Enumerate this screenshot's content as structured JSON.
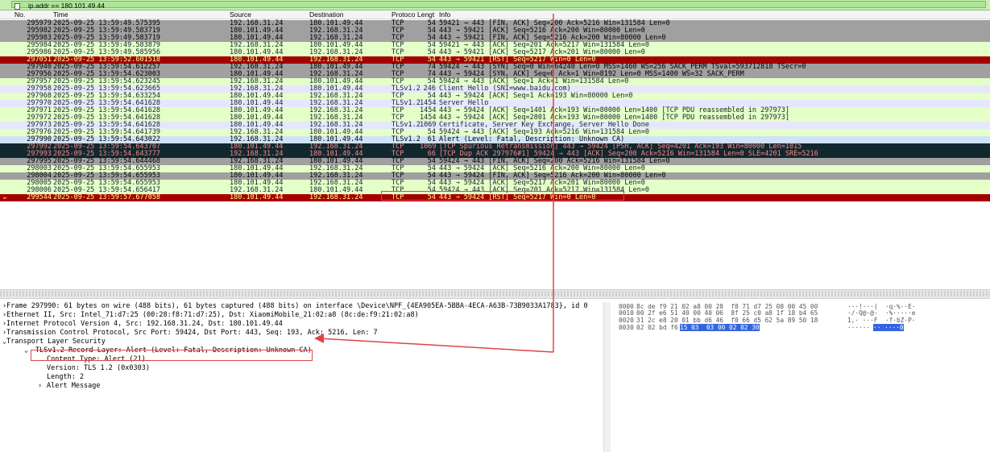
{
  "filter": {
    "value": "ip.addr == 180.101.49.44"
  },
  "columns": {
    "no": "No.",
    "time": "Time",
    "source": "Source",
    "destination": "Destination",
    "protocol": "Protoco",
    "length": "Lengt",
    "info": "Info"
  },
  "packets": [
    {
      "no": "295979",
      "time": "2025-09-25 13:59:49.575395",
      "src": "192.168.31.24",
      "dst": "180.101.49.44",
      "proto": "TCP",
      "len": "54",
      "info": "59421 → 443 [FIN, ACK] Seq=200 Ack=5216 Win=131584 Len=0"
    },
    {
      "no": "295982",
      "time": "2025-09-25 13:59:49.583719",
      "src": "180.101.49.44",
      "dst": "192.168.31.24",
      "proto": "TCP",
      "len": "54",
      "info": "443 → 59421 [ACK] Seq=5216 Ack=200 Win=80000 Len=0"
    },
    {
      "no": "295983",
      "time": "2025-09-25 13:59:49.583719",
      "src": "180.101.49.44",
      "dst": "192.168.31.24",
      "proto": "TCP",
      "len": "54",
      "info": "443 → 59421 [FIN, ACK] Seq=5216 Ack=200 Win=80000 Len=0"
    },
    {
      "no": "295984",
      "time": "2025-09-25 13:59:49.583879",
      "src": "192.168.31.24",
      "dst": "180.101.49.44",
      "proto": "TCP",
      "len": "54",
      "info": "59421 → 443 [ACK] Seq=201 Ack=5217 Win=131584 Len=0"
    },
    {
      "no": "295986",
      "time": "2025-09-25 13:59:49.585956",
      "src": "180.101.49.44",
      "dst": "192.168.31.24",
      "proto": "TCP",
      "len": "54",
      "info": "443 → 59421 [ACK] Seq=5217 Ack=201 Win=80000 Len=0"
    },
    {
      "no": "297051",
      "time": "2025-09-25 13:59:52.601518",
      "src": "180.101.49.44",
      "dst": "192.168.31.24",
      "proto": "TCP",
      "len": "54",
      "info": "443 → 59421 [RST] Seq=5217 Win=0 Len=0"
    },
    {
      "no": "297940",
      "time": "2025-09-25 13:59:54.612257",
      "src": "192.168.31.24",
      "dst": "180.101.49.44",
      "proto": "TCP",
      "len": "74",
      "info": "59424 → 443 [SYN] Seq=0 Win=64240 Len=0 MSS=1460 WS=256 SACK_PERM TSval=593712818 TSecr=0"
    },
    {
      "no": "297956",
      "time": "2025-09-25 13:59:54.623003",
      "src": "180.101.49.44",
      "dst": "192.168.31.24",
      "proto": "TCP",
      "len": "74",
      "info": "443 → 59424 [SYN, ACK] Seq=0 Ack=1 Win=8192 Len=0 MSS=1400 WS=32 SACK_PERM"
    },
    {
      "no": "297957",
      "time": "2025-09-25 13:59:54.623245",
      "src": "192.168.31.24",
      "dst": "180.101.49.44",
      "proto": "TCP",
      "len": "54",
      "info": "59424 → 443 [ACK] Seq=1 Ack=1 Win=131584 Len=0"
    },
    {
      "no": "297958",
      "time": "2025-09-25 13:59:54.623665",
      "src": "192.168.31.24",
      "dst": "180.101.49.44",
      "proto": "TLSv1.2",
      "len": "246",
      "info": "Client Hello (SNI=www.baidu.com)"
    },
    {
      "no": "297968",
      "time": "2025-09-25 13:59:54.633254",
      "src": "180.101.49.44",
      "dst": "192.168.31.24",
      "proto": "TCP",
      "len": "54",
      "info": "443 → 59424 [ACK] Seq=1 Ack=193 Win=80000 Len=0"
    },
    {
      "no": "297970",
      "time": "2025-09-25 13:59:54.641628",
      "src": "180.101.49.44",
      "dst": "192.168.31.24",
      "proto": "TLSv1.2",
      "len": "1454",
      "info": "Server Hello"
    },
    {
      "no": "297971",
      "time": "2025-09-25 13:59:54.641628",
      "src": "180.101.49.44",
      "dst": "192.168.31.24",
      "proto": "TCP",
      "len": "1454",
      "info": "443 → 59424 [ACK] Seq=1401 Ack=193 Win=80000 Len=1400 [TCP PDU reassembled in 297973]"
    },
    {
      "no": "297972",
      "time": "2025-09-25 13:59:54.641628",
      "src": "180.101.49.44",
      "dst": "192.168.31.24",
      "proto": "TCP",
      "len": "1454",
      "info": "443 → 59424 [ACK] Seq=2801 Ack=193 Win=80000 Len=1400 [TCP PDU reassembled in 297973]"
    },
    {
      "no": "297973",
      "time": "2025-09-25 13:59:54.641628",
      "src": "180.101.49.44",
      "dst": "192.168.31.24",
      "proto": "TLSv1.2",
      "len": "1069",
      "info": "Certificate, Server Key Exchange, Server Hello Done"
    },
    {
      "no": "297976",
      "time": "2025-09-25 13:59:54.641739",
      "src": "192.168.31.24",
      "dst": "180.101.49.44",
      "proto": "TCP",
      "len": "54",
      "info": "59424 → 443 [ACK] Seq=193 Ack=5216 Win=131584 Len=0"
    },
    {
      "no": "297990",
      "time": "2025-09-25 13:59:54.643022",
      "src": "192.168.31.24",
      "dst": "180.101.49.44",
      "proto": "TLSv1.2",
      "len": "61",
      "info": "Alert (Level: Fatal, Description: Unknown CA)"
    },
    {
      "no": "297992",
      "time": "2025-09-25 13:59:54.643707",
      "src": "180.101.49.44",
      "dst": "192.168.31.24",
      "proto": "TCP",
      "len": "1069",
      "info": "[TCP Spurious Retransmission] 443 → 59424 [PSH, ACK] Seq=4201 Ack=193 Win=80000 Len=1015"
    },
    {
      "no": "297993",
      "time": "2025-09-25 13:59:54.643777",
      "src": "192.168.31.24",
      "dst": "180.101.49.44",
      "proto": "TCP",
      "len": "66",
      "info": "[TCP Dup ACK 297976#1] 59424 → 443 [ACK] Seq=200 Ack=5216 Win=131584 Len=0 SLE=4201 SRE=5216"
    },
    {
      "no": "297995",
      "time": "2025-09-25 13:59:54.644468",
      "src": "192.168.31.24",
      "dst": "180.101.49.44",
      "proto": "TCP",
      "len": "54",
      "info": "59424 → 443 [FIN, ACK] Seq=200 Ack=5216 Win=131584 Len=0"
    },
    {
      "no": "298003",
      "time": "2025-09-25 13:59:54.655953",
      "src": "180.101.49.44",
      "dst": "192.168.31.24",
      "proto": "TCP",
      "len": "54",
      "info": "443 → 59424 [ACK] Seq=5216 Ack=200 Win=80000 Len=0"
    },
    {
      "no": "298004",
      "time": "2025-09-25 13:59:54.655953",
      "src": "180.101.49.44",
      "dst": "192.168.31.24",
      "proto": "TCP",
      "len": "54",
      "info": "443 → 59424 [FIN, ACK] Seq=5216 Ack=200 Win=80000 Len=0"
    },
    {
      "no": "298005",
      "time": "2025-09-25 13:59:54.655953",
      "src": "180.101.49.44",
      "dst": "192.168.31.24",
      "proto": "TCP",
      "len": "54",
      "info": "443 → 59424 [ACK] Seq=5217 Ack=201 Win=80000 Len=0"
    },
    {
      "no": "298006",
      "time": "2025-09-25 13:59:54.656417",
      "src": "192.168.31.24",
      "dst": "180.101.49.44",
      "proto": "TCP",
      "len": "54",
      "info": "59424 → 443 [ACK] Seq=201 Ack=5217 Win=131584 Len=0"
    },
    {
      "no": "299544",
      "time": "2025-09-25 13:59:57.677058",
      "src": "180.101.49.44",
      "dst": "192.168.31.24",
      "proto": "TCP",
      "len": "54",
      "info": "443 → 59424 [RST] Seq=5217 Win=0 Len=0"
    }
  ],
  "details": {
    "frame": "Frame 297990: 61 bytes on wire (488 bits), 61 bytes captured (488 bits) on interface \\Device\\NPF_{4EA905EA-5BBA-4ECA-A63B-73B9033A1783}, id 0",
    "ethernet": "Ethernet II, Src: Intel_71:d7:25 (00:28:f8:71:d7:25), Dst: XiaomiMobile_21:02:a8 (8c:de:f9:21:02:a8)",
    "ip": "Internet Protocol Version 4, Src: 192.168.31.24, Dst: 180.101.49.44",
    "tcp": "Transmission Control Protocol, Src Port: 59424, Dst Port: 443, Seq: 193, Ack: 5216, Len: 7",
    "tls": "Transport Layer Security",
    "record": "TLSv1.2 Record Layer: Alert (Level: Fatal, Description: Unknown CA)",
    "content_type": "Content Type: Alert (21)",
    "version": "Version: TLS 1.2 (0x0303)",
    "length": "Length: 2",
    "alert_message": "Alert Message"
  },
  "bytes": [
    {
      "offset": "0000",
      "hex": "8c de f9 21 02 a8 00 28  f8 71 d7 25 08 00 45 00",
      "ascii": "···!···(  ·q·%··E·"
    },
    {
      "offset": "0010",
      "hex": "00 2f e6 51 40 00 40 06  8f 25 c0 a8 1f 18 b4 65",
      "ascii": "·/·Q@·@·  ·%·····e"
    },
    {
      "offset": "0020",
      "hex": "31 2c e8 20 01 bb d6 46  f0 66 d5 62 5a 89 50 18",
      "ascii": "1,· ···F  ·f·bZ·P·"
    },
    {
      "offset": "0030",
      "hex_plain": "02 02 bd f6 00 00 ",
      "hex_hl": "15 03  03 00 02 02 30",
      "ascii_plain": "······",
      "ascii_hl": "·· ····0"
    }
  ],
  "colors": {
    "gray": "#a0a0a0",
    "green": "#e4ffc7",
    "blue": "#e7e6ff",
    "red": "#a40000",
    "dark": "#12272e",
    "selected": "#cfe3f7",
    "annotation": "#e04444"
  }
}
